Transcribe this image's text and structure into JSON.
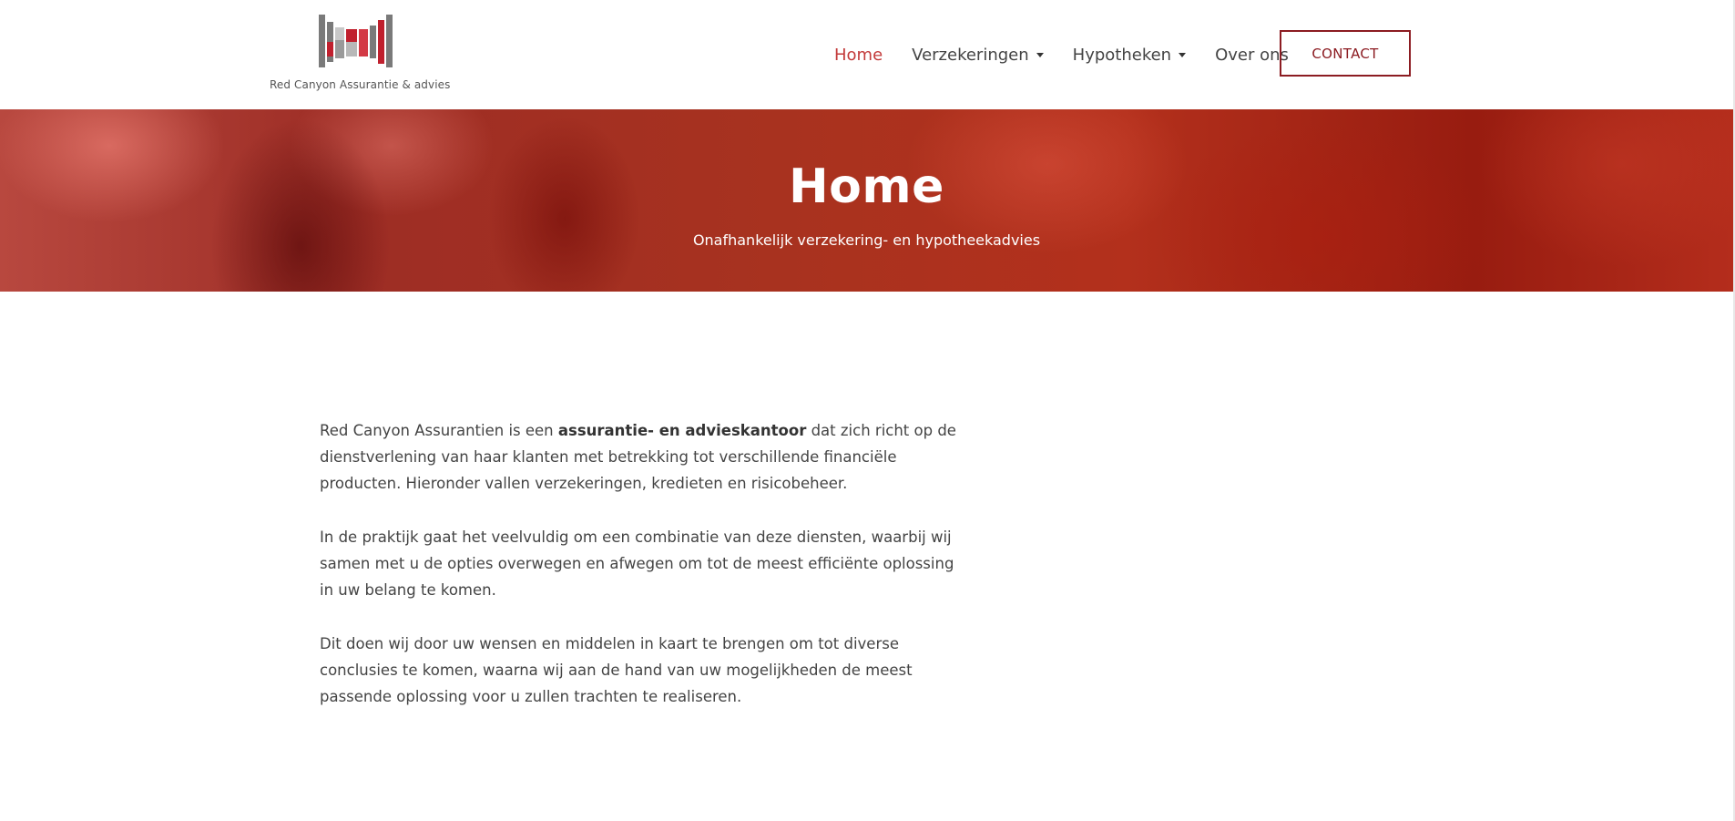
{
  "header": {
    "logo_text": "Red Canyon Assurantie & advies",
    "nav": [
      {
        "label": "Home",
        "active": true,
        "dropdown": false
      },
      {
        "label": "Verzekeringen",
        "active": false,
        "dropdown": true
      },
      {
        "label": "Hypotheken",
        "active": false,
        "dropdown": true
      },
      {
        "label": "Over ons",
        "active": false,
        "dropdown": false
      }
    ],
    "contact_label": "CONTACT"
  },
  "hero": {
    "title": "Home",
    "subtitle": "Onafhankelijk verzekering- en hypotheekadvies"
  },
  "content": {
    "p1_before": "Red Canyon Assurantien is een ",
    "p1_bold": "assurantie- en advieskantoor",
    "p1_after": " dat zich richt op de dienstverlening van haar klanten met betrekking tot verschillende financiële producten. Hieronder vallen verzekeringen, kredieten en risicobeheer.",
    "p2": "In de praktijk gaat het veelvuldig om een combinatie van deze diensten, waarbij wij samen met u de opties overwegen en afwegen om tot de meest efficiënte oplossing in uw belang te komen.",
    "p3": "Dit doen wij door uw wensen en middelen in kaart te brengen om tot diverse conclusies te komen, waarna wij aan de hand van uw mogelijkheden de meest passende oplossing voor u zullen trachten te realiseren."
  },
  "colors": {
    "accent": "#c33a3a",
    "brand_dark_red": "#8c1c22",
    "logo_grey": "#7a7a7a",
    "logo_red": "#c0202e"
  }
}
